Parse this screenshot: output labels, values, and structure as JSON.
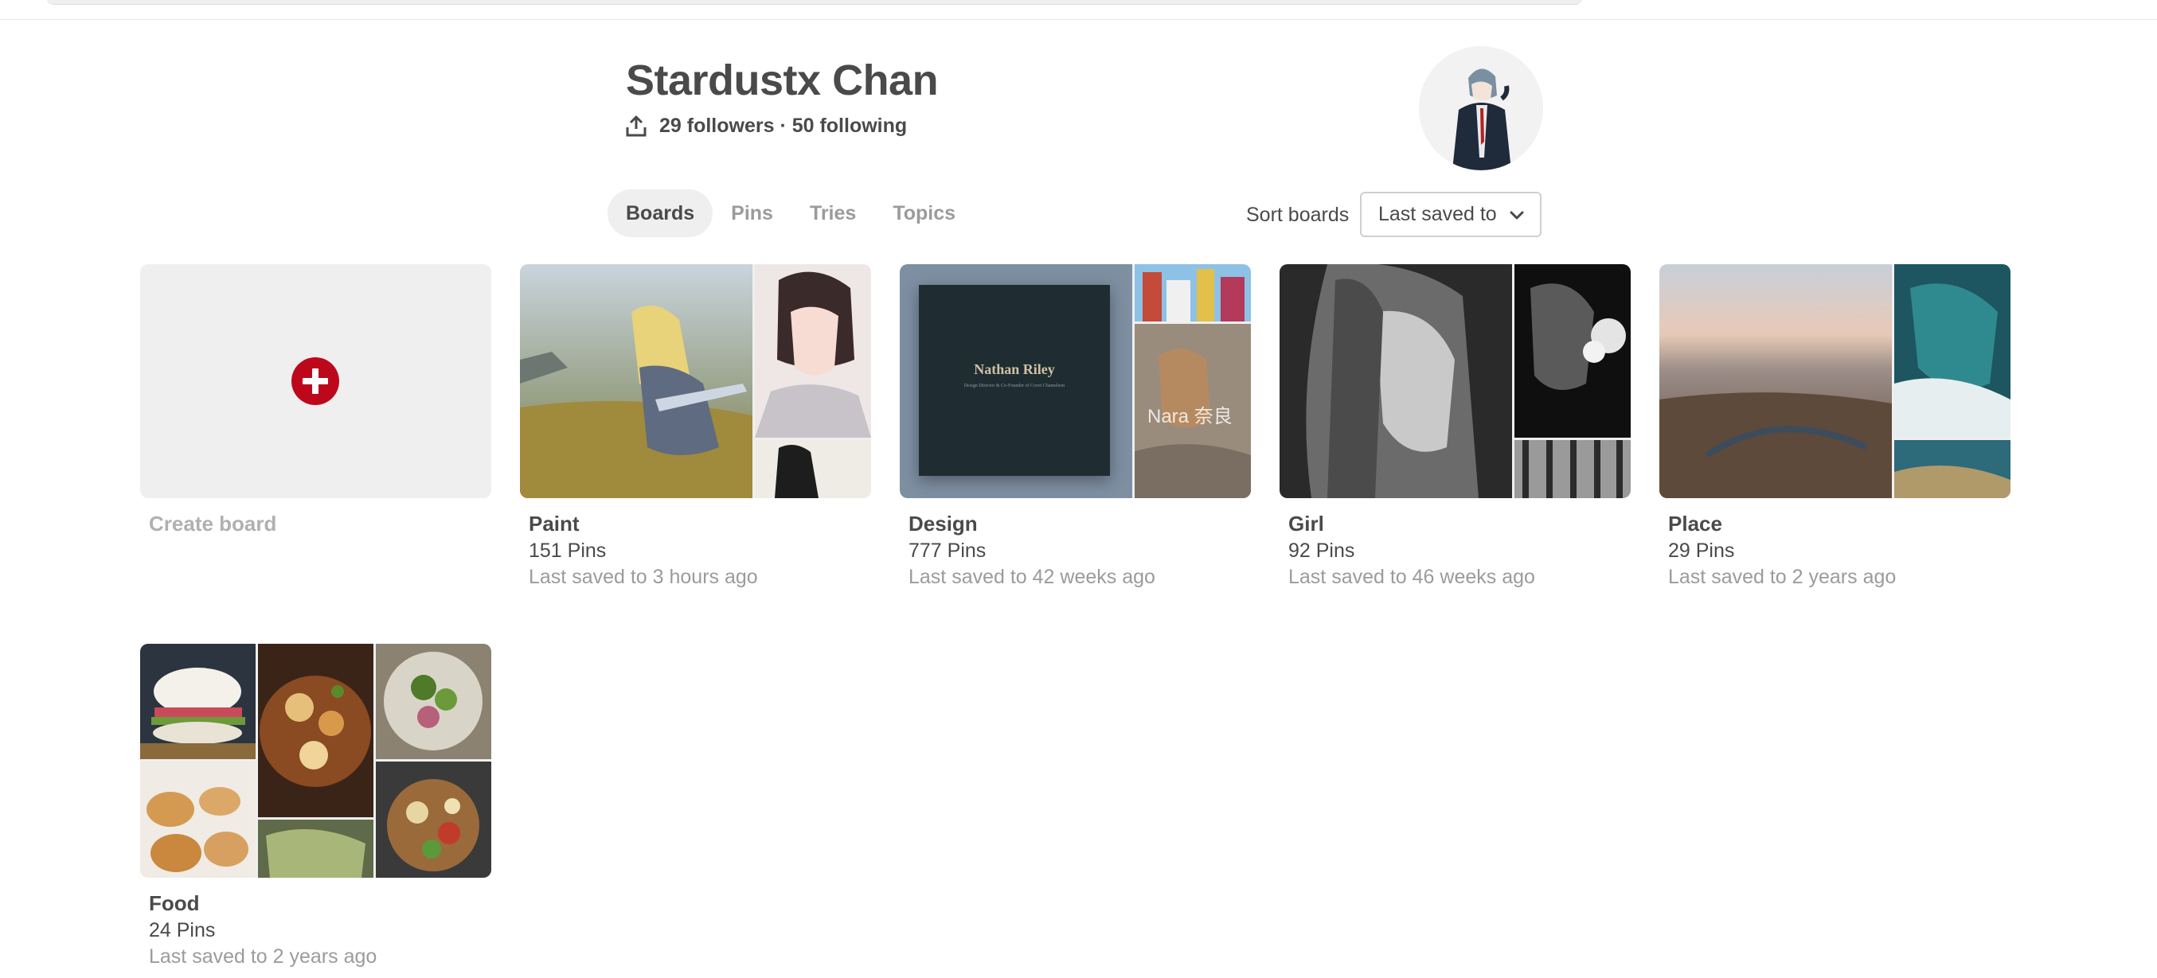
{
  "profile": {
    "name": "Stardustx Chan",
    "stats": "29 followers · 50 following"
  },
  "tabs": [
    {
      "label": "Boards",
      "active": true
    },
    {
      "label": "Pins",
      "active": false
    },
    {
      "label": "Tries",
      "active": false
    },
    {
      "label": "Topics",
      "active": false
    }
  ],
  "sort": {
    "label": "Sort boards",
    "selected": "Last saved to"
  },
  "create_board": {
    "label": "Create board"
  },
  "boards": [
    {
      "title": "Paint",
      "count": "151 Pins",
      "saved": "Last saved to 3 hours ago"
    },
    {
      "title": "Design",
      "count": "777 Pins",
      "saved": "Last saved to 42 weeks ago",
      "cover_text": "Nathan Riley",
      "cover_subtext": "Design Director & Co-Founder of Covet Chameleon",
      "side_text": "Nara 奈良"
    },
    {
      "title": "Girl",
      "count": "92 Pins",
      "saved": "Last saved to 46 weeks ago"
    },
    {
      "title": "Place",
      "count": "29 Pins",
      "saved": "Last saved to 2 years ago"
    },
    {
      "title": "Food",
      "count": "24 Pins",
      "saved": "Last saved to 2 years ago"
    }
  ],
  "colors": {
    "accent_red": "#bd081c",
    "tab_active_bg": "#efefef",
    "muted_text": "#9b9b9b"
  }
}
